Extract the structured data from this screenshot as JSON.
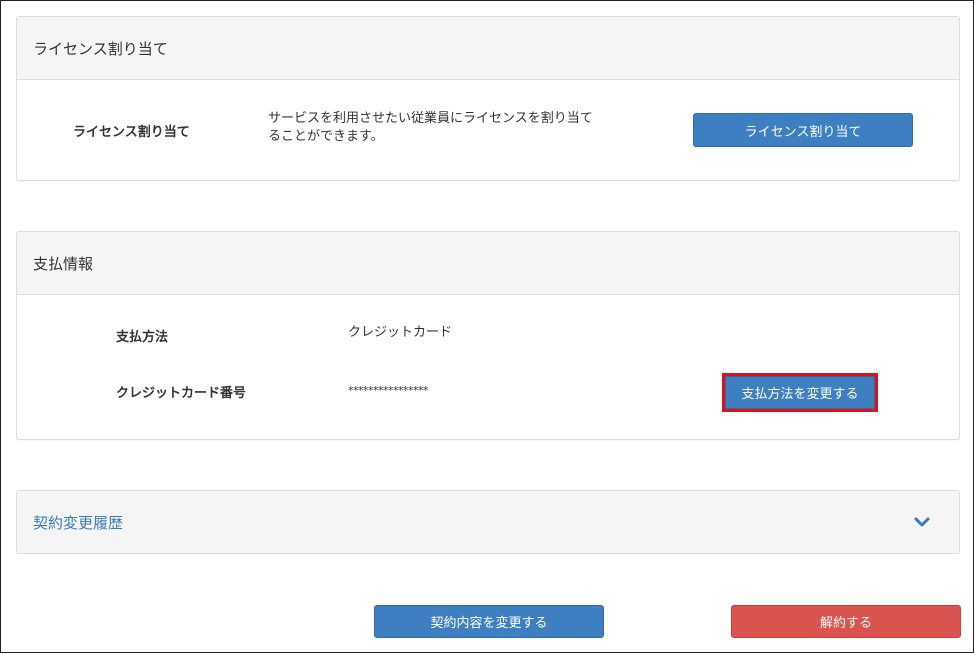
{
  "license_panel": {
    "title": "ライセンス割り当て",
    "row_label": "ライセンス割り当て",
    "description_line1": "サービスを利用させたい従業員にライセンスを割り当て",
    "description_line2": "ることができます。",
    "button_label": "ライセンス割り当て"
  },
  "payment_panel": {
    "title": "支払情報",
    "method_label": "支払方法",
    "method_value": "クレジットカード",
    "card_label": "クレジットカード番号",
    "card_value": "****************",
    "change_button_label": "支払方法を変更する"
  },
  "history_panel": {
    "title": "契約変更履歴",
    "toggle_icon": "chevron-down-icon"
  },
  "footer": {
    "change_contract_label": "契約内容を変更する",
    "cancel_label": "解約する"
  },
  "colors": {
    "primary": "#3d7fc1",
    "danger": "#d9534f",
    "highlight": "#e0101a",
    "link": "#3a7bbf"
  }
}
